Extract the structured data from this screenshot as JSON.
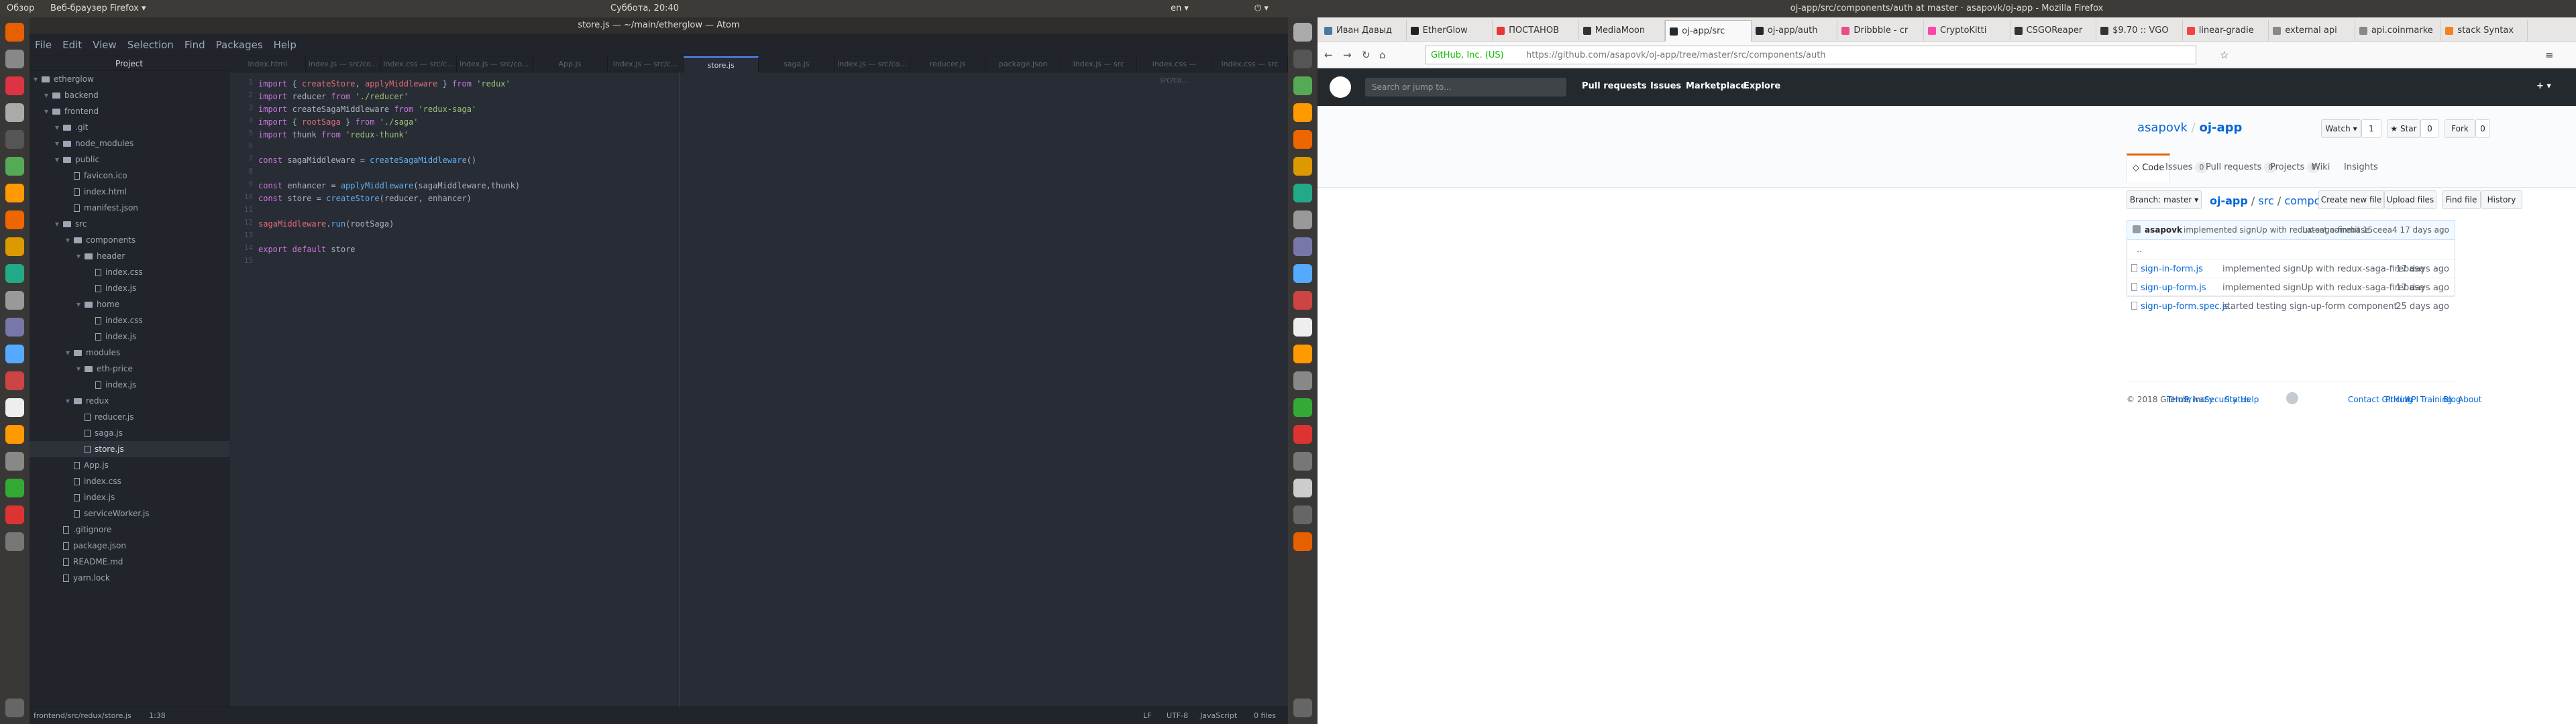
{
  "left": {
    "topbar": {
      "overview": "Обзор",
      "app": "Веб-браузер Firefox ▾",
      "clock": "Суббота, 20:40",
      "lang": "en ▾"
    },
    "atom": {
      "title": "store.js — ~/main/etherglow — Atom",
      "menu": [
        "File",
        "Edit",
        "View",
        "Selection",
        "Find",
        "Packages",
        "Help"
      ],
      "tree_header": "Project",
      "tree": [
        {
          "label": "etherglow",
          "depth": 0,
          "folder": true
        },
        {
          "label": "backend",
          "depth": 1,
          "folder": true
        },
        {
          "label": "frontend",
          "depth": 1,
          "folder": true
        },
        {
          "label": ".git",
          "depth": 2,
          "folder": true
        },
        {
          "label": "node_modules",
          "depth": 2,
          "folder": true
        },
        {
          "label": "public",
          "depth": 2,
          "folder": true
        },
        {
          "label": "favicon.ico",
          "depth": 3,
          "folder": false
        },
        {
          "label": "index.html",
          "depth": 3,
          "folder": false
        },
        {
          "label": "manifest.json",
          "depth": 3,
          "folder": false
        },
        {
          "label": "src",
          "depth": 2,
          "folder": true
        },
        {
          "label": "components",
          "depth": 3,
          "folder": true
        },
        {
          "label": "header",
          "depth": 4,
          "folder": true
        },
        {
          "label": "index.css",
          "depth": 5,
          "folder": false
        },
        {
          "label": "index.js",
          "depth": 5,
          "folder": false
        },
        {
          "label": "home",
          "depth": 4,
          "folder": true
        },
        {
          "label": "index.css",
          "depth": 5,
          "folder": false
        },
        {
          "label": "index.js",
          "depth": 5,
          "folder": false
        },
        {
          "label": "modules",
          "depth": 3,
          "folder": true
        },
        {
          "label": "eth-price",
          "depth": 4,
          "folder": true
        },
        {
          "label": "index.js",
          "depth": 5,
          "folder": false
        },
        {
          "label": "redux",
          "depth": 3,
          "folder": true
        },
        {
          "label": "reducer.js",
          "depth": 4,
          "folder": false
        },
        {
          "label": "saga.js",
          "depth": 4,
          "folder": false
        },
        {
          "label": "store.js",
          "depth": 4,
          "folder": false,
          "selected": true
        },
        {
          "label": "App.js",
          "depth": 3,
          "folder": false
        },
        {
          "label": "index.css",
          "depth": 3,
          "folder": false
        },
        {
          "label": "index.js",
          "depth": 3,
          "folder": false
        },
        {
          "label": "serviceWorker.js",
          "depth": 3,
          "folder": false
        },
        {
          "label": ".gitignore",
          "depth": 2,
          "folder": false
        },
        {
          "label": "package.json",
          "depth": 2,
          "folder": false
        },
        {
          "label": "README.md",
          "depth": 2,
          "folder": false
        },
        {
          "label": "yarn.lock",
          "depth": 2,
          "folder": false
        }
      ],
      "tabs": [
        {
          "label": "index.html"
        },
        {
          "label": "index.js — src/co..."
        },
        {
          "label": "index.css — src/c..."
        },
        {
          "label": "index.js — src/co..."
        },
        {
          "label": "App.js"
        },
        {
          "label": "index.js — src/c..."
        },
        {
          "label": "store.js",
          "active": true
        },
        {
          "label": "saga.js"
        },
        {
          "label": "index.js — src/co..."
        },
        {
          "label": "reducer.js"
        },
        {
          "label": "package.json"
        },
        {
          "label": "index.js — src"
        },
        {
          "label": "index.css — src/co..."
        },
        {
          "label": "index.css — src"
        }
      ],
      "code": [
        [
          {
            "t": "import",
            "c": "kw"
          },
          {
            "t": " { "
          },
          {
            "t": "createStore",
            "c": "vr"
          },
          {
            "t": ", "
          },
          {
            "t": "applyMiddleware",
            "c": "vr"
          },
          {
            "t": " } "
          },
          {
            "t": "from",
            "c": "kw"
          },
          {
            "t": " "
          },
          {
            "t": "'redux'",
            "c": "st"
          }
        ],
        [
          {
            "t": "import",
            "c": "kw"
          },
          {
            "t": " reducer "
          },
          {
            "t": "from",
            "c": "kw"
          },
          {
            "t": " "
          },
          {
            "t": "'./reducer'",
            "c": "st"
          }
        ],
        [
          {
            "t": "import",
            "c": "kw"
          },
          {
            "t": " createSagaMiddleware "
          },
          {
            "t": "from",
            "c": "kw"
          },
          {
            "t": " "
          },
          {
            "t": "'redux-saga'",
            "c": "st"
          }
        ],
        [
          {
            "t": "import",
            "c": "kw"
          },
          {
            "t": " { "
          },
          {
            "t": "rootSaga",
            "c": "vr"
          },
          {
            "t": " } "
          },
          {
            "t": "from",
            "c": "kw"
          },
          {
            "t": " "
          },
          {
            "t": "'./saga'",
            "c": "st"
          }
        ],
        [
          {
            "t": "import",
            "c": "kw"
          },
          {
            "t": " thunk "
          },
          {
            "t": "from",
            "c": "kw"
          },
          {
            "t": " "
          },
          {
            "t": "'redux-thunk'",
            "c": "st"
          }
        ],
        [],
        [
          {
            "t": "const",
            "c": "kw"
          },
          {
            "t": " sagaMiddleware = "
          },
          {
            "t": "createSagaMiddleware",
            "c": "fn"
          },
          {
            "t": "()"
          }
        ],
        [],
        [
          {
            "t": "const",
            "c": "kw"
          },
          {
            "t": " enhancer = "
          },
          {
            "t": "applyMiddleware",
            "c": "fn"
          },
          {
            "t": "(sagaMiddleware,thunk)"
          }
        ],
        [
          {
            "t": "const",
            "c": "kw"
          },
          {
            "t": " store = "
          },
          {
            "t": "createStore",
            "c": "fn"
          },
          {
            "t": "(reducer, enhancer)"
          }
        ],
        [],
        [
          {
            "t": "sagaMiddleware",
            "c": "vr"
          },
          {
            "t": "."
          },
          {
            "t": "run",
            "c": "fn"
          },
          {
            "t": "(rootSaga)"
          }
        ],
        [],
        [
          {
            "t": "export",
            "c": "kw"
          },
          {
            "t": " "
          },
          {
            "t": "default",
            "c": "kw"
          },
          {
            "t": " store"
          }
        ],
        []
      ],
      "status": {
        "path": "frontend/src/redux/store.js",
        "pos": "1:38",
        "eol": "LF",
        "enc": "UTF-8",
        "grammar": "JavaScript",
        "files": "0 files"
      }
    }
  },
  "right": {
    "title": "oj-app/src/components/auth at master · asapovk/oj-app - Mozilla Firefox",
    "tabs": [
      {
        "label": "Иван Давыд",
        "color": "#4a76a8"
      },
      {
        "label": "EtherGlow",
        "color": "#222"
      },
      {
        "label": "ПОСТАНОВ",
        "color": "#e33"
      },
      {
        "label": "MediaMoon",
        "color": "#333"
      },
      {
        "label": "oj-app/src",
        "color": "#24292e",
        "active": true
      },
      {
        "label": "oj-app/auth",
        "color": "#24292e"
      },
      {
        "label": "Dribbble - cr",
        "color": "#ea4c89"
      },
      {
        "label": "CryptoKitti",
        "color": "#f4a"
      },
      {
        "label": "CSGOReaper",
        "color": "#333"
      },
      {
        "label": "$9.70 :: VGO",
        "color": "#333"
      },
      {
        "label": "linear-gradie",
        "color": "#e44"
      },
      {
        "label": "external api",
        "color": "#888"
      },
      {
        "label": "api.coinmarke",
        "color": "#888"
      },
      {
        "label": "stack Syntax",
        "color": "#f48024"
      }
    ],
    "url": {
      "secure": "GitHub, Inc. (US)",
      "address": "https://github.com/asapovk/oj-app/tree/master/src/components/auth"
    },
    "gh": {
      "search": "Search or jump to...",
      "nav": [
        "Pull requests",
        "Issues",
        "Marketplace",
        "Explore"
      ],
      "owner": "asapovk",
      "repo": "oj-app",
      "watch": "Watch ▾",
      "watch_n": "1",
      "star": "★ Star",
      "star_n": "0",
      "fork": "Fork",
      "fork_n": "0",
      "rtabs": [
        {
          "label": "◇ Code",
          "sel": true
        },
        {
          "label": "Issues",
          "count": "0"
        },
        {
          "label": "Pull requests",
          "count": "0"
        },
        {
          "label": "Projects",
          "count": "0"
        },
        {
          "label": "Wiki"
        },
        {
          "label": "Insights"
        }
      ],
      "branch": "Branch: master ▾",
      "crumbs": [
        "oj-app",
        "src",
        "components",
        "auth"
      ],
      "actions": [
        "Create new file",
        "Upload files",
        "Find file",
        "History"
      ],
      "commit": {
        "author": "asapovk",
        "msg": "implemented signUp with redux-saga-firebase",
        "latest": "Latest commit 15ceea4 17 days ago"
      },
      "updir": "..",
      "files": [
        {
          "name": "sign-in-form.js",
          "msg": "implemented signUp with redux-saga-firebase",
          "age": "17 days ago"
        },
        {
          "name": "sign-up-form.js",
          "msg": "implemented signUp with redux-saga-firebase",
          "age": "17 days ago"
        },
        {
          "name": "sign-up-form.spec.js",
          "msg": "started testing sign-up-form component",
          "age": "25 days ago"
        }
      ],
      "footer_left": [
        "© 2018 GitHub, Inc.",
        "Terms",
        "Privacy",
        "Security",
        "Status",
        "Help"
      ],
      "footer_right": [
        "Contact GitHub",
        "Pricing",
        "API",
        "Training",
        "Blog",
        "About"
      ]
    }
  }
}
